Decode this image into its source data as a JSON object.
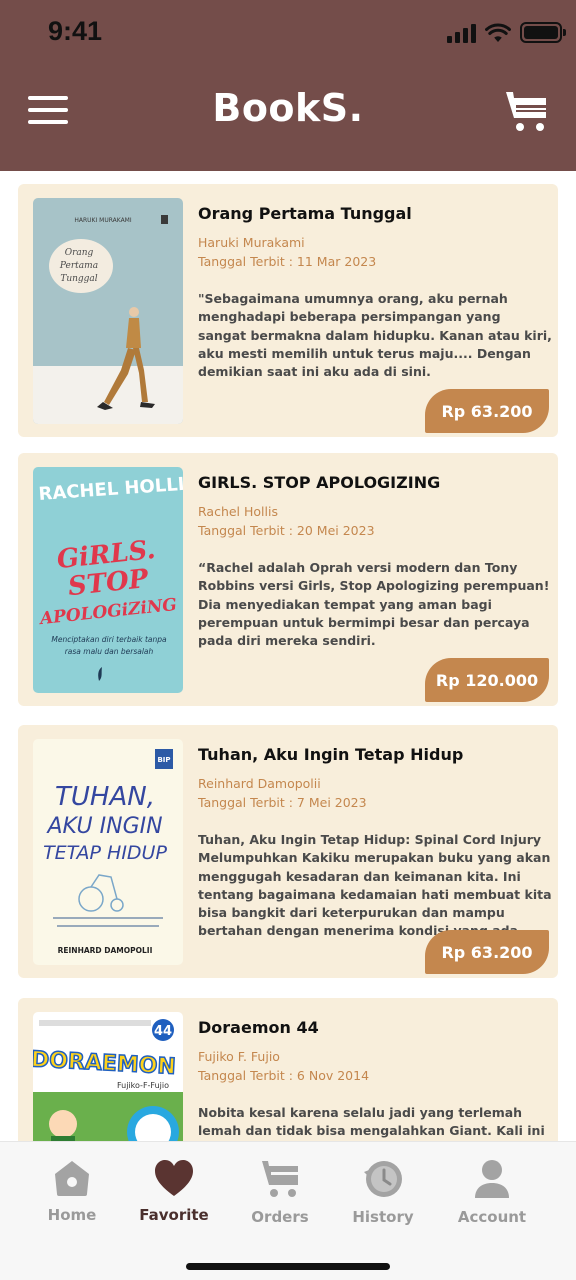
{
  "status": {
    "time": "9:41"
  },
  "header": {
    "title": "BookS."
  },
  "books": [
    {
      "title": "Orang Pertama Tunggal",
      "author": "Haruki Murakami",
      "date": "Tanggal Terbit : 11 Mar 2023",
      "description": "\"Sebagaimana umumnya orang, aku pernah menghadapi beberapa persimpangan yang sangat bermakna dalam hidupku. Kanan atau kiri, aku mesti memilih untuk terus maju.... Dengan demikian saat ini aku ada di sini.",
      "price": "Rp 63.200",
      "cover": {
        "author": "HARUKI MURAKAMI",
        "title_l1": "Orang",
        "title_l2": "Pertama",
        "title_l3": "Tunggal"
      }
    },
    {
      "title": "GIRLS. STOP APOLOGIZING",
      "author": "Rachel Hollis",
      "date": "Tanggal Terbit : 20 Mei 2023",
      "description": "“Rachel adalah Oprah versi modern dan Tony Robbins versi Girls, Stop Apologizing perempuan! Dia menyediakan tempat yang aman bagi perempuan untuk bermimpi besar dan percaya pada diri mereka sendiri.",
      "price": "Rp 120.000",
      "cover": {
        "author": "RACHEL HOLLIS",
        "title_l1": "GiRLS.",
        "title_l2": "STOP",
        "title_l3": "APOLOGiZiNG",
        "tagline_l1": "Menciptakan diri terbaik tanpa",
        "tagline_l2": "rasa malu dan bersalah"
      }
    },
    {
      "title": "Tuhan, Aku Ingin Tetap Hidup",
      "author": "Reinhard Damopolii",
      "date": "Tanggal Terbit : 7 Mei 2023",
      "description": "Tuhan, Aku Ingin Tetap Hidup: Spinal Cord Injury Melumpuhkan Kakiku merupakan buku yang akan menggugah kesadaran dan keimanan kita. Ini tentang bagaimana kedamaian hati membuat kita bisa bangkit dari keterpurukan dan mampu bertahan dengan menerima kondisi yang ada.",
      "price": "Rp 63.200",
      "cover": {
        "title_l1": "TUHAN,",
        "title_l2": "AKU INGIN",
        "title_l3": "TETAP HIDUP",
        "publisher": "BIP",
        "author": "REINHARD DAMOPOLII"
      }
    },
    {
      "title": "Doraemon 44",
      "author": "Fujiko F. Fujio",
      "date": "Tanggal Terbit : 6 Nov 2014",
      "description": "Nobita kesal karena selalu jadi yang terlemah lemah dan tidak bisa mengalahkan Giant. Kali ini Doraemon punya",
      "price": "",
      "cover": {
        "title": "DORAEMON",
        "volume": "44",
        "author": "Fujiko-F-Fujio"
      }
    }
  ],
  "tabs": [
    {
      "label": "Home",
      "icon": "home-icon"
    },
    {
      "label": "Favorite",
      "icon": "heart-icon"
    },
    {
      "label": "Orders",
      "icon": "cart-icon"
    },
    {
      "label": "History",
      "icon": "history-icon"
    },
    {
      "label": "Account",
      "icon": "account-icon"
    }
  ],
  "colors": {
    "header": "#744d4a",
    "card": "#f8eedb",
    "accent": "#c4874e",
    "active_tab": "#4a2f2d",
    "inactive_tab": "#9a9a9a"
  }
}
